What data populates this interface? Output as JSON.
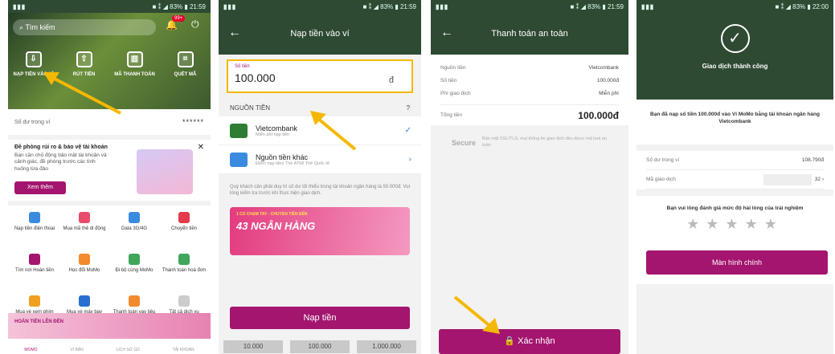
{
  "status": {
    "signal": "▮▮▮",
    "p1_right": "■ ⁑ ◢ 83% ▮ 21:59",
    "p2_right": "■ ⁑ ◢ 83% ▮ 21:59",
    "p3_right": "■ ⁑ ◢ 83% ▮ 21:59",
    "p4_right": "■ ⁑ ◢ 83% ▮ 22:00"
  },
  "home": {
    "search_placeholder": "Tìm kiếm",
    "badge": "99+",
    "tiles": [
      {
        "label": "NẠP TIỀN VÀO VÍ",
        "icon": "deposit-icon"
      },
      {
        "label": "RÚT TIỀN",
        "icon": "withdraw-icon"
      },
      {
        "label": "MÃ THANH TOÁN",
        "icon": "barcode-icon"
      },
      {
        "label": "QUÉT MÃ",
        "icon": "scan-icon"
      }
    ],
    "balance_label": "Số dư trong ví",
    "balance_masked": "******",
    "promo_title": "Đề phòng rủi ro & bảo vệ tài khoản",
    "promo_text": "Bạn cần chủ động bảo mật tài khoản và cảnh giác, đề phòng trước các tình huống lừa đảo",
    "promo_button": "Xem thêm",
    "services": [
      {
        "label": "Nạp tiền điện thoại",
        "color": "#3a8be0"
      },
      {
        "label": "Mua mã thẻ di động",
        "color": "#e94b6a"
      },
      {
        "label": "Data 3G/4G",
        "color": "#3a8be0"
      },
      {
        "label": "Chuyển tiền",
        "color": "#e33b4b"
      },
      {
        "label": "Tìm nơi Hoàn tiền",
        "color": "#a3156f"
      },
      {
        "label": "Học đổi MoMo",
        "color": "#f28a2e"
      },
      {
        "label": "Đi bộ cùng MoMo",
        "color": "#3fa65b"
      },
      {
        "label": "Thanh toán hoá đơn",
        "color": "#3fa65b"
      },
      {
        "label": "Mua vé xem phim",
        "color": "#f0a020"
      },
      {
        "label": "Mua vé máy bay",
        "color": "#2a6fd0"
      },
      {
        "label": "Thanh toán vay tiêu dùng",
        "color": "#f28a2e"
      },
      {
        "label": "Tất cả dịch vụ",
        "color": "#cccccc"
      }
    ],
    "banner": "HOÀN TIỀN LÊN ĐẾN",
    "nav": [
      "MOMO",
      "VÍ BẢN",
      "LỊCH SỬ GD",
      "TÀI KHOẢN"
    ]
  },
  "topup": {
    "title": "Nạp tiền vào ví",
    "amount_label": "Số tiền",
    "amount_value": "100.000",
    "currency": "đ",
    "source_heading": "NGUỒN TIỀN",
    "sources": [
      {
        "name": "Vietcombank",
        "sub": "Miễn phí nạp tiền",
        "color": "#2e7d32",
        "check": "✓"
      },
      {
        "name": "Nguồn tiền khác",
        "sub": "Điểm nạp tiền/ Thẻ ATM/ Thẻ Quốc tế",
        "color": "#3a8be0",
        "check": "›"
      }
    ],
    "note": "Quý khách cần phải duy trì số dư tối thiểu trong tài khoản ngân hàng là 50.000đ. Vui lòng kiểm tra trước khi thực hiện giao dịch.",
    "promo_line": "1 CÚ CHẠM TAY - CHUYỂN TIỀN ĐẾN",
    "promo_big": "43 NGÂN HÀNG",
    "button": "Nạp tiền",
    "chips": [
      "10.000",
      "100.000",
      "1.000.000"
    ]
  },
  "payment": {
    "title": "Thanh toán an toàn",
    "rows": [
      {
        "label": "Nguồn tiền",
        "value": "Vietcombank"
      },
      {
        "label": "Số tiền",
        "value": "100.000đ"
      },
      {
        "label": "Phí giao dịch",
        "value": "Miễn phí"
      }
    ],
    "total_label": "Tổng tiền",
    "total_value": "100.000đ",
    "secure_logo": "Secure",
    "secure_text": "Bảo mật SSL/TLS, mọi thông tin giao dịch đều được mã hoá an toàn",
    "confirm": "Xác nhận"
  },
  "success": {
    "title": "Giao dịch thành công",
    "message": "Bạn đã nạp số tiền 100.000đ vào Ví MoMo bằng tài khoản ngân hàng Vietcombank",
    "balance_label": "Số dư trong ví",
    "balance_value": "108.790đ",
    "txn_label": "Mã giao dịch",
    "txn_value": "32",
    "rate_prompt": "Bạn vui lòng đánh giá mức độ hài lòng của trải nghiệm",
    "stars": "★★★★★",
    "button": "Màn hình chính"
  }
}
